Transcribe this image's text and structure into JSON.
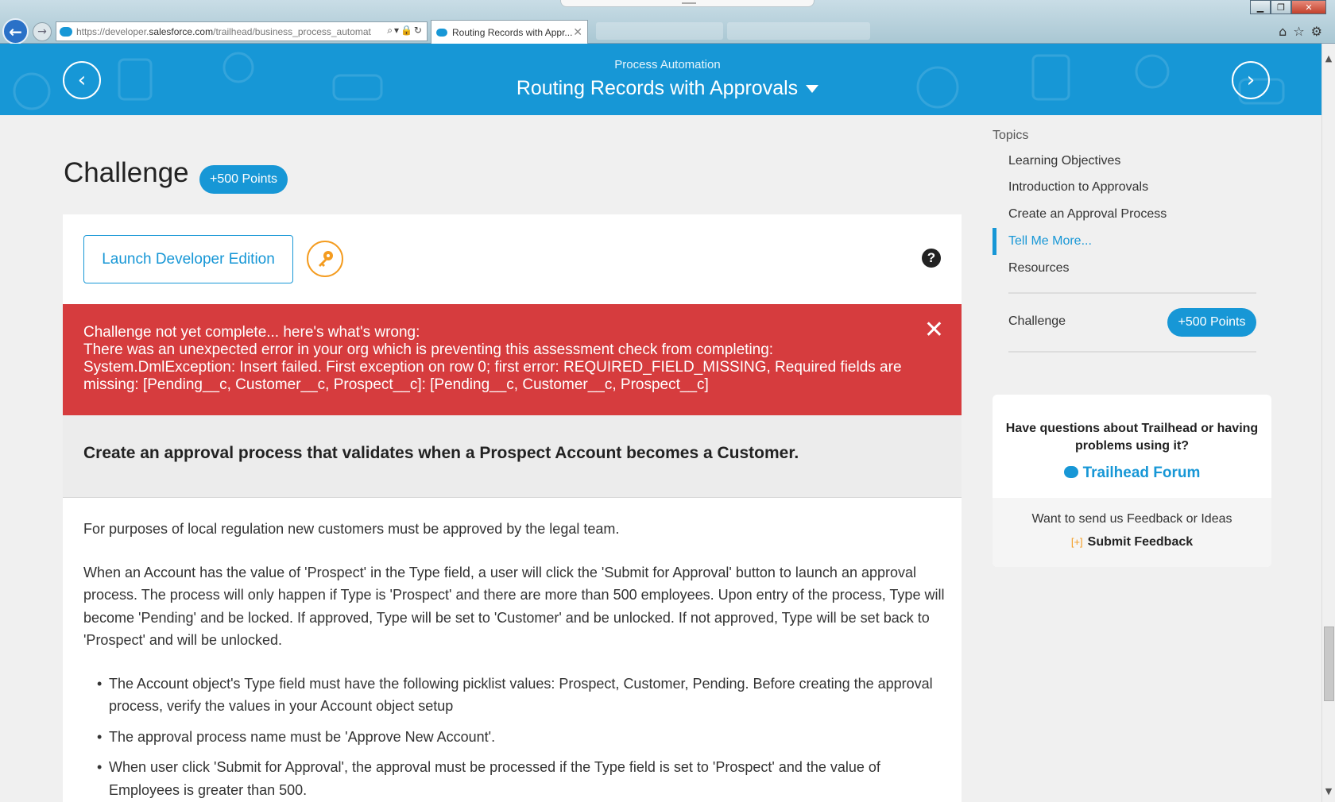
{
  "browser": {
    "url_prefix": "https://developer.",
    "url_domain": "salesforce.com",
    "url_path": "/trailhead/business_process_automat",
    "tab_title": "Routing Records with Appr...",
    "tab_close": "✕"
  },
  "banner": {
    "module": "Process Automation",
    "unit": "Routing Records with Approvals"
  },
  "challenge": {
    "title": "Challenge",
    "points": "+500 Points",
    "launch_label": "Launch Developer Edition",
    "help": "?",
    "error_lines": [
      "Challenge not yet complete... here's what's wrong:",
      "There was an unexpected error in your org which is preventing this assessment check from completing:",
      "System.DmlException: Insert failed. First exception on row 0; first error: REQUIRED_FIELD_MISSING, Required fields are",
      "missing: [Pending__c, Customer__c, Prospect__c]: [Pending__c, Customer__c, Prospect__c]"
    ],
    "goal": "Create an approval process that validates when a Prospect Account becomes a Customer.",
    "paragraphs": [
      "For purposes of local regulation new customers must be approved by the legal team.",
      "When an Account has the value of 'Prospect' in the Type field, a user will click the 'Submit for Approval' button to launch an approval process. The process will only happen if Type is 'Prospect' and there are more than 500 employees. Upon entry of the process, Type will become 'Pending' and be locked. If approved, Type will be set to 'Customer' and be unlocked. If not approved, Type will be set back to 'Prospect' and will be unlocked."
    ],
    "bullets": [
      "The Account object's Type field must have the following picklist values: Prospect, Customer, Pending. Before creating the approval process, verify the values in your Account object setup",
      "The approval process name must be 'Approve New Account'.",
      "When user click 'Submit for Approval', the approval must be processed if the Type field is set to 'Prospect' and the value of Employees is greater than 500."
    ]
  },
  "sidebar": {
    "heading": "Topics",
    "items": [
      {
        "label": "Learning Objectives"
      },
      {
        "label": "Introduction to Approvals"
      },
      {
        "label": "Create an Approval Process"
      },
      {
        "label": "Tell Me More..."
      },
      {
        "label": "Resources"
      }
    ],
    "challenge_label": "Challenge",
    "challenge_points": "+500 Points",
    "help_question": "Have questions about Trailhead or having problems using it?",
    "forum_link": "Trailhead Forum",
    "feedback_question": "Want to send us Feedback or Ideas",
    "feedback_icon": "[+]",
    "feedback_link": "Submit Feedback"
  },
  "colors": {
    "brand_blue": "#1797d6",
    "error_red": "#d63c3e",
    "key_orange": "#f49c20"
  }
}
